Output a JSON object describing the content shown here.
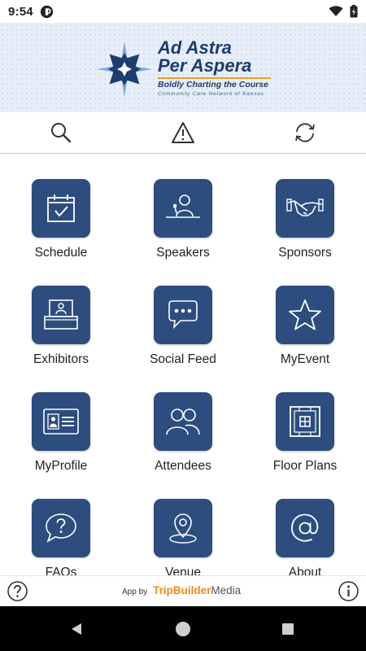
{
  "status_bar": {
    "time": "9:54"
  },
  "banner": {
    "title_line1": "Ad Astra",
    "title_line2": "Per Aspera",
    "tagline": "Boldly Charting the Course",
    "organization": "Community Care Network of Kansas"
  },
  "toolbar": {
    "items": [
      {
        "icon": "search-icon"
      },
      {
        "icon": "alert-icon"
      },
      {
        "icon": "refresh-icon"
      }
    ]
  },
  "grid": {
    "tiles": [
      {
        "label": "Schedule",
        "icon": "calendar-check-icon"
      },
      {
        "label": "Speakers",
        "icon": "speaker-podium-icon"
      },
      {
        "label": "Sponsors",
        "icon": "handshake-icon"
      },
      {
        "label": "Exhibitors",
        "icon": "exhibitor-booth-icon"
      },
      {
        "label": "Social Feed",
        "icon": "chat-bubble-icon"
      },
      {
        "label": "MyEvent",
        "icon": "star-icon"
      },
      {
        "label": "MyProfile",
        "icon": "id-card-icon"
      },
      {
        "label": "Attendees",
        "icon": "people-icon"
      },
      {
        "label": "Floor Plans",
        "icon": "floor-plan-icon"
      },
      {
        "label": "FAQs",
        "icon": "question-bubble-icon"
      },
      {
        "label": "Venue",
        "icon": "map-pin-icon"
      },
      {
        "label": "About",
        "icon": "at-sign-icon"
      }
    ]
  },
  "footer": {
    "credit_prefix": "App by",
    "credit_brand": "TripBuilder",
    "credit_brand_suffix": "Media"
  },
  "colors": {
    "tile_background": "#2c4d7e",
    "brand_navy": "#1c3d6e",
    "brand_gold": "#e0a32a",
    "tripbuilder_orange": "#f08a1c"
  }
}
